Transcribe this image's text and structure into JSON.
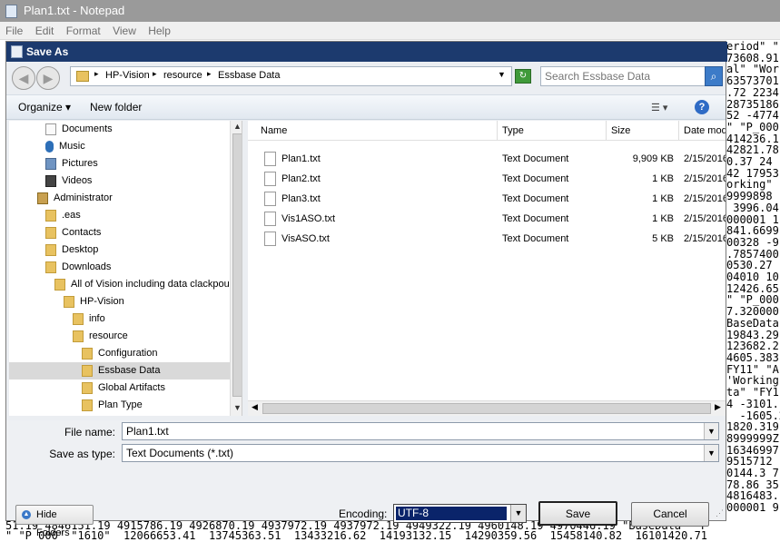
{
  "notepad": {
    "title": "Plan1.txt - Notepad",
    "menu": [
      "File",
      "Edit",
      "Format",
      "View",
      "Help"
    ],
    "side_text": "eriod\" \"\n73608.91\nal\" \"Wor\n63573701\n.72 2234\n28735186\n52 -4774\n\" \"P_000\n414236.1\n42821.78\n0.37 24\n42 17953\norking\"\n9999898\n 3996.04\n000001 1\n841.6699\n00328 -9\n.7857400\n0530.27\n04010 10\n12426.65\n\" \"P_000\n7.320000\nBaseData\n19843.29\n123682.2\n4605.383\nFY11\" \"A\n'Working\nta\" \"FY1\n4 -3101.\n  -1605.2\n1820.319\n8999999Z\n16346997\n9515712\n0144.3 7\n78.86 35\n4816483.\n000001 9",
    "bottom_text": "51.19 4846151.19 4915786.19 4926870.19 4937972.19 4937972.19 4949322.19 4960148.19 4970446.19 \"BaseData\" \"F\n\" \"P_000\" \"1610\"  12066653.41  13745363.51  13433216.62  14193132.15  14290359.56  15458140.82  16101420.71"
  },
  "dialog": {
    "title": "Save As",
    "breadcrumb": [
      "HP-Vision",
      "resource",
      "Essbase Data"
    ],
    "search_placeholder": "Search Essbase Data",
    "organize": "Organize ▾",
    "new_folder": "New folder",
    "tree": [
      {
        "label": "Documents",
        "icon": "doc"
      },
      {
        "label": "Music",
        "icon": "music"
      },
      {
        "label": "Pictures",
        "icon": "pic"
      },
      {
        "label": "Videos",
        "icon": "vid"
      },
      {
        "label": "Administrator",
        "icon": "user"
      },
      {
        "label": ".eas",
        "icon": "folder"
      },
      {
        "label": "Contacts",
        "icon": "folder"
      },
      {
        "label": "Desktop",
        "icon": "folder"
      },
      {
        "label": "Downloads",
        "icon": "folder"
      },
      {
        "label": "All of Vision including data clackpour",
        "icon": "folder"
      },
      {
        "label": "HP-Vision",
        "icon": "folder"
      },
      {
        "label": "info",
        "icon": "folder"
      },
      {
        "label": "resource",
        "icon": "folder"
      },
      {
        "label": "Configuration",
        "icon": "folder"
      },
      {
        "label": "Essbase Data",
        "icon": "folder",
        "selected": true
      },
      {
        "label": "Global Artifacts",
        "icon": "folder"
      },
      {
        "label": "Plan Type",
        "icon": "folder"
      }
    ],
    "columns": {
      "name": "Name",
      "type": "Type",
      "size": "Size",
      "date": "Date modif"
    },
    "files": [
      {
        "name": "Plan1.txt",
        "type": "Text Document",
        "size": "9,909 KB",
        "date": "2/15/2016"
      },
      {
        "name": "Plan2.txt",
        "type": "Text Document",
        "size": "1 KB",
        "date": "2/15/2016"
      },
      {
        "name": "Plan3.txt",
        "type": "Text Document",
        "size": "1 KB",
        "date": "2/15/2016"
      },
      {
        "name": "Vis1ASO.txt",
        "type": "Text Document",
        "size": "1 KB",
        "date": "2/15/2016"
      },
      {
        "name": "VisASO.txt",
        "type": "Text Document",
        "size": "5 KB",
        "date": "2/15/2016"
      }
    ],
    "file_name_label": "File name:",
    "file_name_value": "Plan1.txt",
    "save_type_label": "Save as type:",
    "save_type_value": "Text Documents (*.txt)",
    "hide_folders": "Hide Folders",
    "encoding_label": "Encoding:",
    "encoding_value": "UTF-8",
    "save": "Save",
    "cancel": "Cancel"
  }
}
